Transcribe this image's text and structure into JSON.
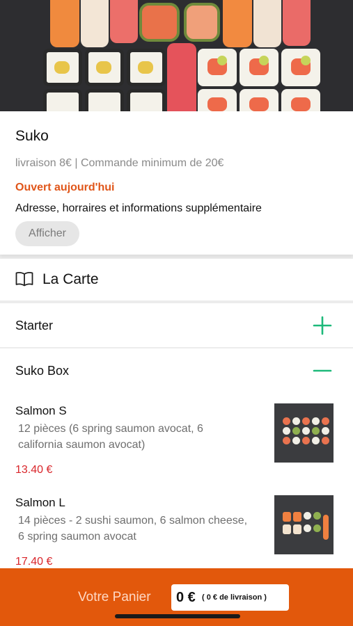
{
  "restaurant": {
    "name": "Suko",
    "delivery_info": "livraison 8€ | Commande minimum de 20€",
    "open_status": "Ouvert aujourd'hui",
    "address_info": "Adresse, horraires et informations supplémentaire",
    "show_button": "Afficher"
  },
  "menu": {
    "header": "La Carte",
    "header_icon": "book-open-icon",
    "categories": [
      {
        "label": "Starter",
        "state": "collapsed",
        "icon": "plus-icon"
      },
      {
        "label": "Suko Box",
        "state": "expanded",
        "icon": "minus-icon"
      }
    ],
    "products": [
      {
        "name": "Salmon S",
        "description": "12 pièces (6 spring saumon avocat, 6 california saumon avocat)",
        "price": "13.40 €"
      },
      {
        "name": "Salmon L",
        "description": "14 pièces - 2 sushi saumon, 6 salmon cheese, 6 spring saumon avocat",
        "price": "17.40 €"
      }
    ]
  },
  "cart": {
    "label": "Votre Panier",
    "amount": "0 €",
    "delivery_fee": "( 0 € de livraison )"
  },
  "colors": {
    "accent": "#e2580c",
    "open_text": "#e0561a",
    "price": "#d9262b",
    "toggle": "#1db97a"
  }
}
